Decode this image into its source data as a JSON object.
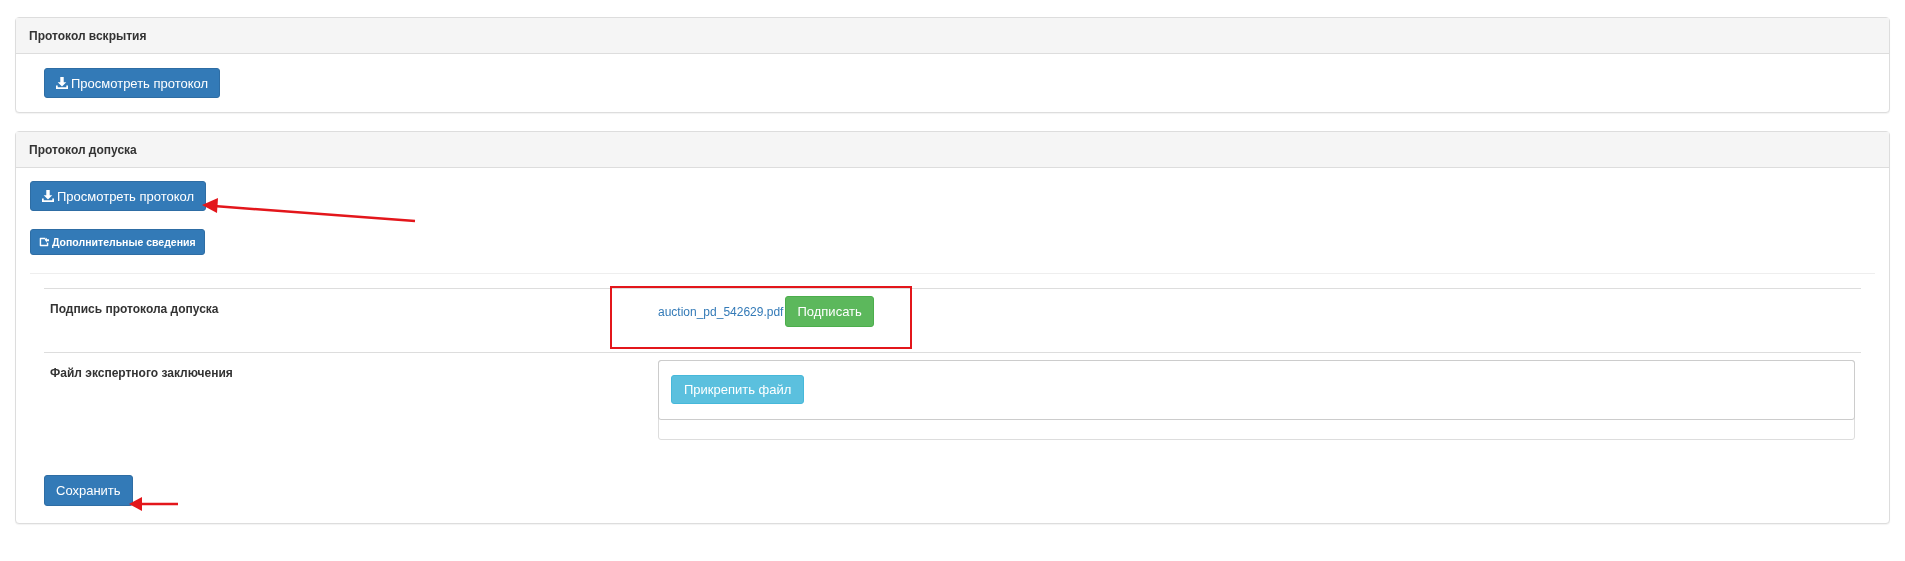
{
  "panels": [
    {
      "title": "Протокол вскрытия",
      "buttons": [
        {
          "kind": "download",
          "label": "Просмотреть протокол",
          "small": false
        }
      ]
    },
    {
      "title": "Протокол допуска",
      "buttons": [
        {
          "kind": "download",
          "label": "Просмотреть протокол",
          "small": false
        },
        {
          "kind": "external",
          "label": "Дополнительные сведения",
          "small": true
        }
      ],
      "rows": [
        {
          "kind": "sign",
          "label": "Подпись протокола допуска",
          "file": "auction_pd_542629.pdf",
          "button": "Подписать"
        },
        {
          "kind": "upload",
          "label": "Файл экспертного заключения",
          "button": "Прикрепить файл"
        }
      ],
      "save_button": "Сохранить"
    }
  ]
}
